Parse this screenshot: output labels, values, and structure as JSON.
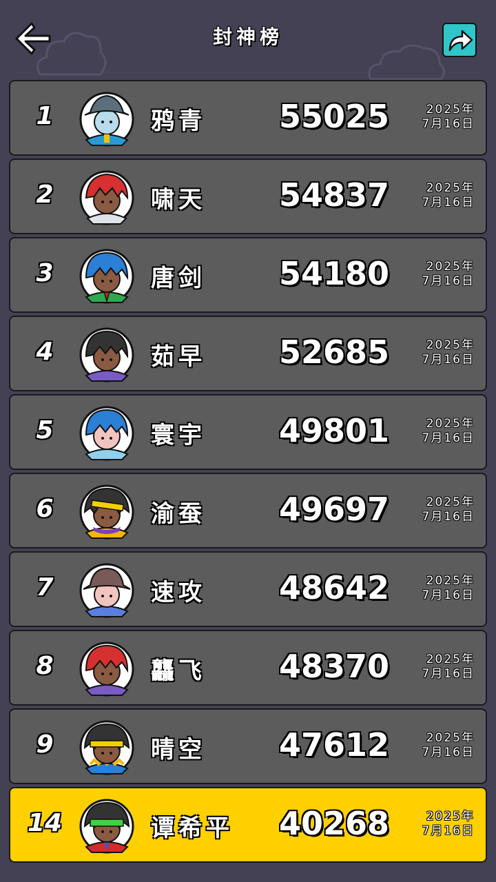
{
  "header": {
    "title": "封神榜",
    "back_icon": "arrow-left-icon",
    "share_icon": "share-icon"
  },
  "colors": {
    "background": "#444155",
    "row": "#5c5c5c",
    "row_highlight": "#ffd000",
    "share_button": "#2ec6c9"
  },
  "leaderboard": [
    {
      "rank": "1",
      "name": "鸦青",
      "score": "55025",
      "year": "2025年",
      "day": "7月16日"
    },
    {
      "rank": "2",
      "name": "啸天",
      "score": "54837",
      "year": "2025年",
      "day": "7月16日"
    },
    {
      "rank": "3",
      "name": "唐剑",
      "score": "54180",
      "year": "2025年",
      "day": "7月16日"
    },
    {
      "rank": "4",
      "name": "茹早",
      "score": "52685",
      "year": "2025年",
      "day": "7月16日"
    },
    {
      "rank": "5",
      "name": "寰宇",
      "score": "49801",
      "year": "2025年",
      "day": "7月16日"
    },
    {
      "rank": "6",
      "name": "渝蚕",
      "score": "49697",
      "year": "2025年",
      "day": "7月16日"
    },
    {
      "rank": "7",
      "name": "速攻",
      "score": "48642",
      "year": "2025年",
      "day": "7月16日"
    },
    {
      "rank": "8",
      "name": "龘飞",
      "score": "48370",
      "year": "2025年",
      "day": "7月16日"
    },
    {
      "rank": "9",
      "name": "晴空",
      "score": "47612",
      "year": "2025年",
      "day": "7月16日"
    },
    {
      "rank": "14",
      "name": "谭希平",
      "score": "40268",
      "year": "2025年",
      "day": "7月16日"
    }
  ]
}
